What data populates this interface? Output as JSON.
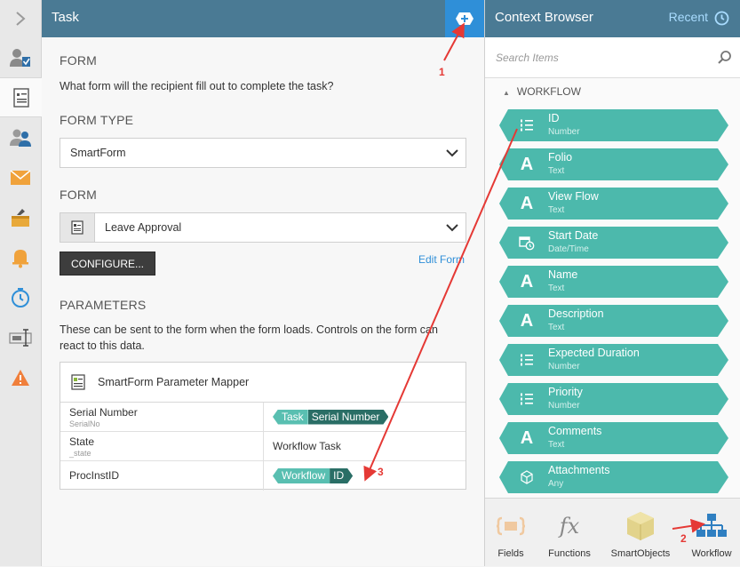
{
  "rail": {
    "toggle_icon": "chevron-right-icon"
  },
  "header": {
    "title": "Task",
    "add_icon": "add-icon"
  },
  "form": {
    "section_label": "FORM",
    "question": "What form will the recipient fill out to complete the task?",
    "form_type_label": "FORM TYPE",
    "form_type_value": "SmartForm",
    "form_label": "FORM",
    "form_value": "Leave Approval",
    "configure_label": "CONFIGURE...",
    "edit_form_label": "Edit Form"
  },
  "parameters": {
    "section_label": "PARAMETERS",
    "description": "These can be sent to the form when the form loads. Controls on the form can react to this data.",
    "mapper_title": "SmartForm Parameter Mapper",
    "rows": [
      {
        "name": "Serial Number",
        "sub": "SerialNo",
        "tag_a": "Task",
        "tag_b": "Serial Number",
        "text": ""
      },
      {
        "name": "State",
        "sub": "_state",
        "tag_a": "",
        "tag_b": "",
        "text": "Workflow Task"
      },
      {
        "name": "ProcInstID",
        "sub": "",
        "tag_a": "Workflow",
        "tag_b": "ID",
        "text": ""
      }
    ]
  },
  "context_browser": {
    "title": "Context Browser",
    "recent_label": "Recent",
    "search_placeholder": "Search Items",
    "group_label": "WORKFLOW",
    "items": [
      {
        "name": "ID",
        "type": "Number",
        "icon": "number-icon"
      },
      {
        "name": "Folio",
        "type": "Text",
        "icon": "text-icon"
      },
      {
        "name": "View Flow",
        "type": "Text",
        "icon": "text-icon"
      },
      {
        "name": "Start Date",
        "type": "Date/Time",
        "icon": "datetime-icon"
      },
      {
        "name": "Name",
        "type": "Text",
        "icon": "text-icon"
      },
      {
        "name": "Description",
        "type": "Text",
        "icon": "text-icon"
      },
      {
        "name": "Expected Duration",
        "type": "Number",
        "icon": "number-icon"
      },
      {
        "name": "Priority",
        "type": "Number",
        "icon": "number-icon"
      },
      {
        "name": "Comments",
        "type": "Text",
        "icon": "text-icon"
      },
      {
        "name": "Attachments",
        "type": "Any",
        "icon": "any-icon"
      }
    ],
    "footer": [
      {
        "label": "Fields",
        "icon": "fields-icon"
      },
      {
        "label": "Functions",
        "icon": "functions-icon"
      },
      {
        "label": "SmartObjects",
        "icon": "smartobjects-icon"
      },
      {
        "label": "Workflow",
        "icon": "workflow-icon"
      }
    ]
  },
  "annotations": {
    "one": "1",
    "two": "2",
    "three": "3"
  },
  "colors": {
    "header": "#4a7a94",
    "accent": "#2f8fd8",
    "item": "#4cb9ac",
    "tag_dark": "#2a6e66",
    "annotation": "#e53935"
  }
}
